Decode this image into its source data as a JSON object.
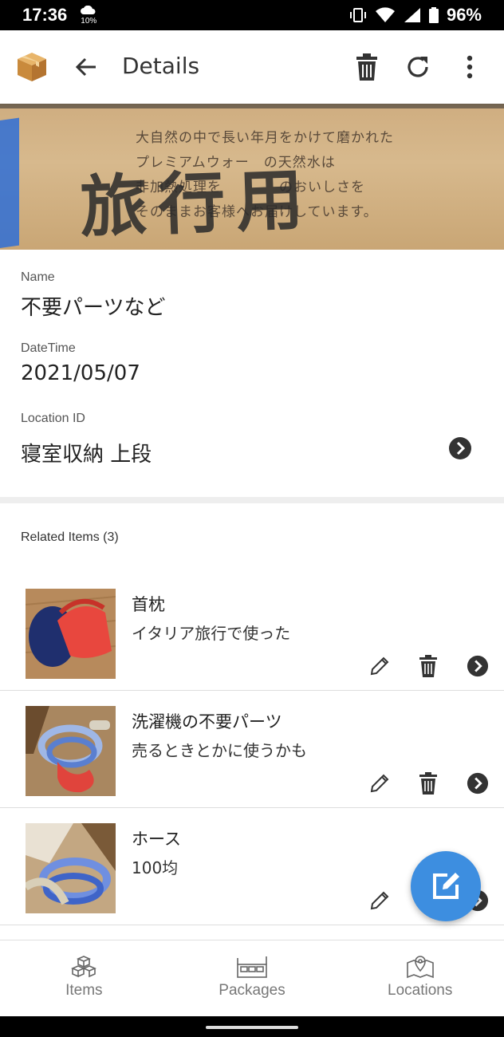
{
  "status": {
    "time": "17:36",
    "weather_pct": "10%",
    "battery": "96%"
  },
  "header": {
    "title": "Details"
  },
  "hero": {
    "printed_lines": [
      "大自然の中で長い年月をかけて磨かれた",
      "プレミアムウォー　の天然水は",
      "非加熱処理を　　　　のおいしさを",
      "そのままお客様へお届けしています。"
    ],
    "handwriting": "旅行用"
  },
  "details": {
    "name_label": "Name",
    "name_value": "不要パーツなど",
    "datetime_label": "DateTime",
    "datetime_value": "2021/05/07",
    "location_label": "Location ID",
    "location_value": "寝室収納 上段"
  },
  "related": {
    "title": "Related Items (3)",
    "items": [
      {
        "title": "首枕",
        "subtitle": "イタリア旅行で使った"
      },
      {
        "title": "洗濯機の不要パーツ",
        "subtitle": "売るときとかに使うかも"
      },
      {
        "title": "ホース",
        "subtitle": "100均"
      }
    ]
  },
  "nav": {
    "items": [
      {
        "label": "Items"
      },
      {
        "label": "Packages"
      },
      {
        "label": "Locations"
      }
    ]
  },
  "colors": {
    "accent": "#3d8ee0",
    "icon": "#333333"
  }
}
